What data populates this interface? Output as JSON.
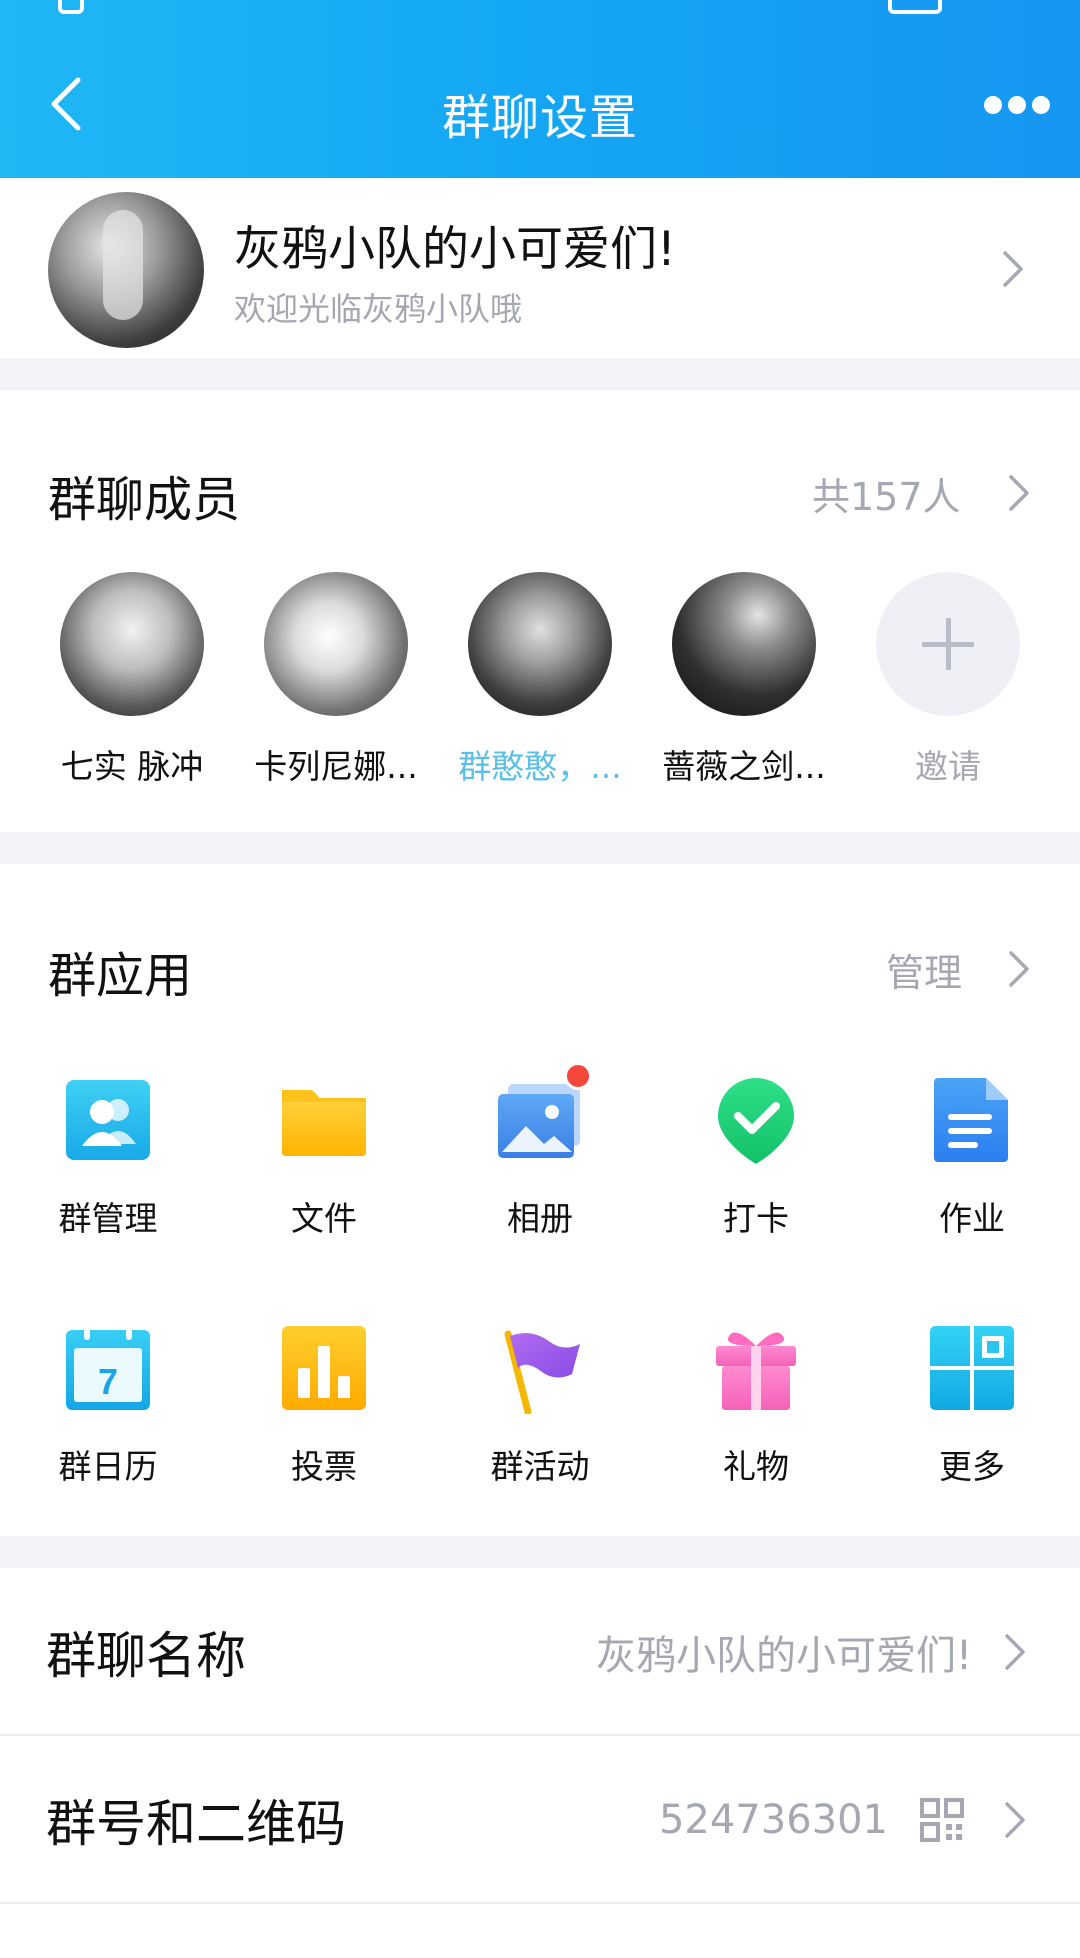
{
  "header": {
    "title": "群聊设置"
  },
  "group": {
    "name": "灰鸦小队的小可爱们!",
    "description": "欢迎光临灰鸦小队哦"
  },
  "members": {
    "title": "群聊成员",
    "count_label": "共157人",
    "items": [
      {
        "name": "七实 脉冲"
      },
      {
        "name": "卡列尼娜..."
      },
      {
        "name": "群憨憨，..."
      },
      {
        "name": "蔷薇之剑..."
      }
    ],
    "invite_label": "邀请"
  },
  "apps": {
    "title": "群应用",
    "manage_label": "管理",
    "items": [
      {
        "label": "群管理",
        "icon": "group-manage-icon"
      },
      {
        "label": "文件",
        "icon": "folder-icon"
      },
      {
        "label": "相册",
        "icon": "album-icon"
      },
      {
        "label": "打卡",
        "icon": "checkin-icon"
      },
      {
        "label": "作业",
        "icon": "homework-icon"
      },
      {
        "label": "群日历",
        "icon": "calendar-icon",
        "day": "7"
      },
      {
        "label": "投票",
        "icon": "vote-icon"
      },
      {
        "label": "群活动",
        "icon": "flag-icon"
      },
      {
        "label": "礼物",
        "icon": "gift-icon"
      },
      {
        "label": "更多",
        "icon": "more-apps-icon"
      }
    ]
  },
  "settings": {
    "group_name_label": "群聊名称",
    "group_name_value": "灰鸦小队的小可爱们!",
    "group_id_label": "群号和二维码",
    "group_id_value": "524736301"
  },
  "colors": {
    "header_start": "#20b7f5",
    "header_end": "#1697f2",
    "muted_text": "#a5a8b1",
    "badge": "#f5473b"
  }
}
